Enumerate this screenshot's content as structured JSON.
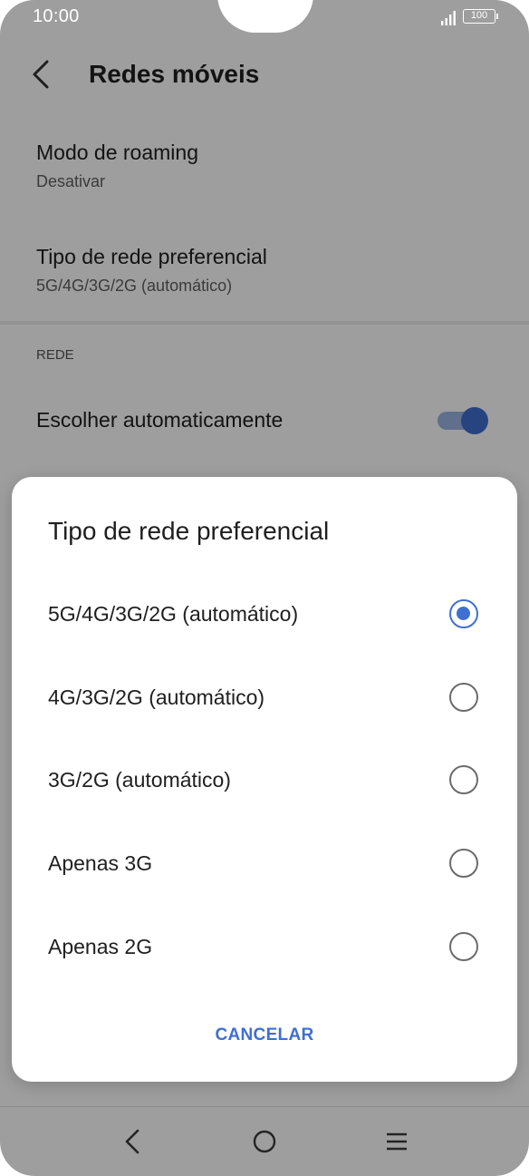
{
  "status_bar": {
    "time": "10:00",
    "battery": "100",
    "signal_icon": "signal-bars-icon",
    "battery_icon": "battery-icon"
  },
  "screen": {
    "title": "Redes móveis",
    "back_icon": "back-arrow-icon",
    "items": [
      {
        "title": "Modo de roaming",
        "subtitle": "Desativar"
      },
      {
        "title": "Tipo de rede preferencial",
        "subtitle": "5G/4G/3G/2G (automático)"
      }
    ],
    "section_header": "REDE",
    "auto_select": {
      "label": "Escolher automaticamente",
      "enabled": true
    }
  },
  "dialog": {
    "title": "Tipo de rede preferencial",
    "options": [
      {
        "label": "5G/4G/3G/2G (automático)",
        "selected": true
      },
      {
        "label": "4G/3G/2G (automático)",
        "selected": false
      },
      {
        "label": "3G/2G (automático)",
        "selected": false
      },
      {
        "label": "Apenas 3G",
        "selected": false
      },
      {
        "label": "Apenas 2G",
        "selected": false
      }
    ],
    "cancel_label": "CANCELAR"
  },
  "nav_bar": {
    "back_icon": "nav-back-icon",
    "home_icon": "nav-home-icon",
    "menu_icon": "nav-menu-icon"
  },
  "colors": {
    "accent": "#3f6fd1",
    "scrim": "rgba(0,0,0,0.38)"
  }
}
